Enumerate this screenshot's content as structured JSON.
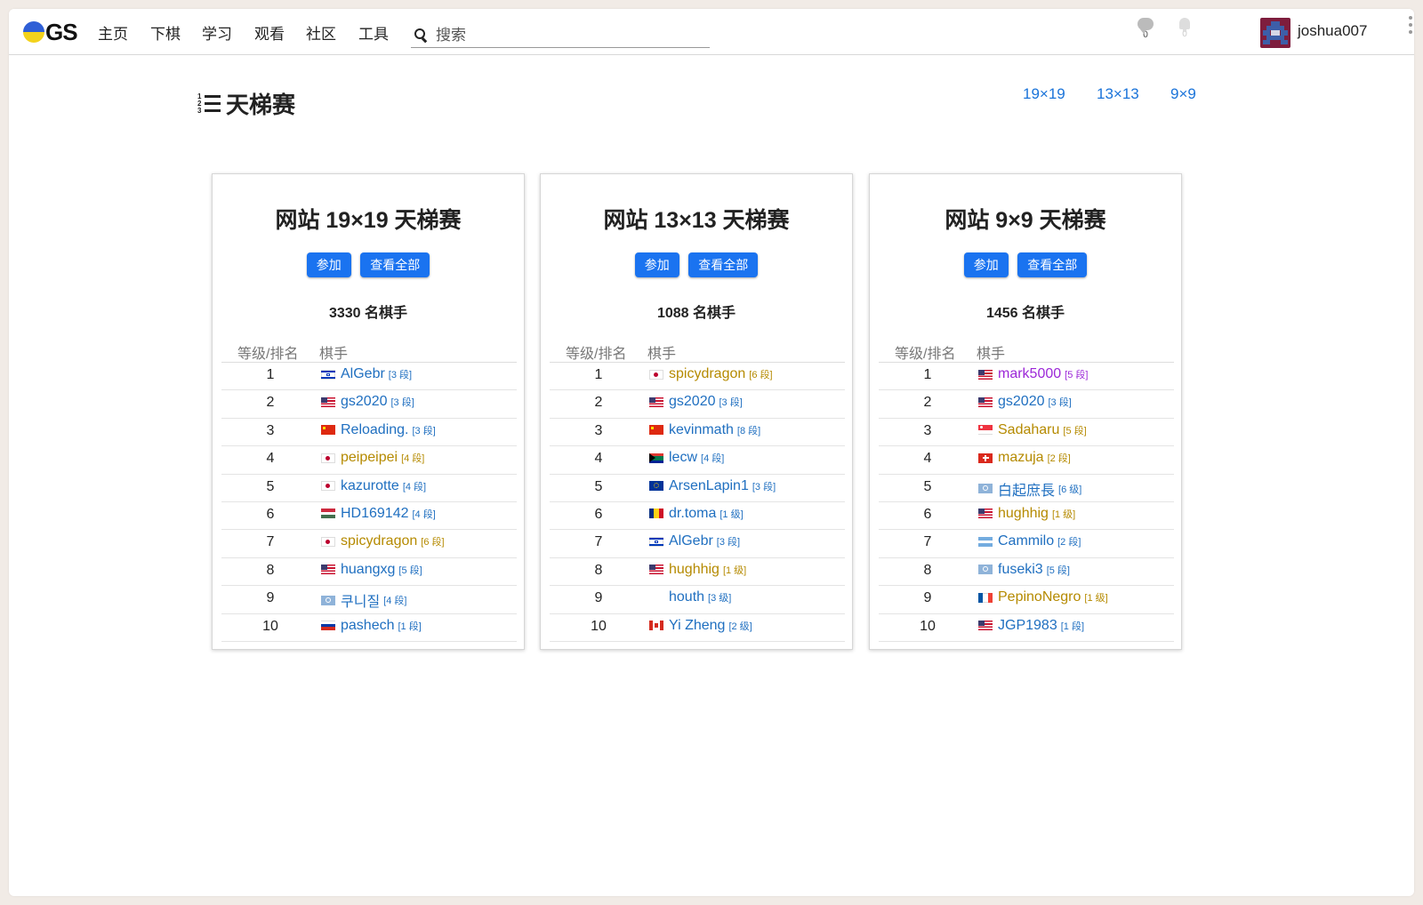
{
  "nav": {
    "logo_text": "GS",
    "items": [
      "主页",
      "下棋",
      "学习",
      "观看",
      "社区",
      "工具"
    ],
    "search_placeholder": "搜索",
    "chat_count": "0",
    "notif_count": "0",
    "username": "joshua007",
    "logo_colors": {
      "top": "#2f5fd6",
      "bottom": "#f3d21c"
    }
  },
  "page": {
    "title": "天梯赛",
    "size_links": [
      "19×19",
      "13×13",
      "9×9"
    ]
  },
  "header_cols": {
    "rank": "等级/排名",
    "player": "棋手"
  },
  "buttons": {
    "join": "参加",
    "view_all": "查看全部"
  },
  "ladders": [
    {
      "title": "网站 19×19 天梯赛",
      "players_count": "3330 名棋手",
      "rows": [
        {
          "rank": "1",
          "flag": "il",
          "name": "AlGebr",
          "rk": "[3 段]",
          "color": "blue"
        },
        {
          "rank": "2",
          "flag": "us",
          "name": "gs2020",
          "rk": "[3 段]",
          "color": "blue"
        },
        {
          "rank": "3",
          "flag": "cn",
          "name": "Reloading.",
          "rk": "[3 段]",
          "color": "blue"
        },
        {
          "rank": "4",
          "flag": "jp",
          "name": "peipeipei",
          "rk": "[4 段]",
          "color": "gold"
        },
        {
          "rank": "5",
          "flag": "jp",
          "name": "kazurotte",
          "rk": "[4 段]",
          "color": "blue"
        },
        {
          "rank": "6",
          "flag": "hu",
          "name": "HD169142",
          "rk": "[4 段]",
          "color": "blue"
        },
        {
          "rank": "7",
          "flag": "jp",
          "name": "spicydragon",
          "rk": "[6 段]",
          "color": "gold"
        },
        {
          "rank": "8",
          "flag": "us",
          "name": "huangxg",
          "rk": "[5 段]",
          "color": "blue"
        },
        {
          "rank": "9",
          "flag": "un",
          "name": "쿠니질",
          "rk": "[4 段]",
          "color": "blue"
        },
        {
          "rank": "10",
          "flag": "ru",
          "name": "pashech",
          "rk": "[1 段]",
          "color": "blue"
        }
      ]
    },
    {
      "title": "网站 13×13 天梯赛",
      "players_count": "1088 名棋手",
      "rows": [
        {
          "rank": "1",
          "flag": "jp",
          "name": "spicydragon",
          "rk": "[6 段]",
          "color": "gold"
        },
        {
          "rank": "2",
          "flag": "us",
          "name": "gs2020",
          "rk": "[3 段]",
          "color": "blue"
        },
        {
          "rank": "3",
          "flag": "cn",
          "name": "kevinmath",
          "rk": "[8 段]",
          "color": "blue"
        },
        {
          "rank": "4",
          "flag": "za",
          "name": "lecw",
          "rk": "[4 段]",
          "color": "blue"
        },
        {
          "rank": "5",
          "flag": "eu",
          "name": "ArsenLapin1",
          "rk": "[3 段]",
          "color": "blue"
        },
        {
          "rank": "6",
          "flag": "ro",
          "name": "dr.toma",
          "rk": "[1 级]",
          "color": "blue"
        },
        {
          "rank": "7",
          "flag": "il",
          "name": "AlGebr",
          "rk": "[3 段]",
          "color": "blue"
        },
        {
          "rank": "8",
          "flag": "us",
          "name": "hughhig",
          "rk": "[1 级]",
          "color": "gold"
        },
        {
          "rank": "9",
          "flag": "none",
          "name": "houth",
          "rk": "[3 级]",
          "color": "blue"
        },
        {
          "rank": "10",
          "flag": "ca",
          "name": "Yi Zheng",
          "rk": "[2 级]",
          "color": "blue"
        }
      ]
    },
    {
      "title": "网站 9×9 天梯赛",
      "players_count": "1456 名棋手",
      "rows": [
        {
          "rank": "1",
          "flag": "us",
          "name": "mark5000",
          "rk": "[5 段]",
          "color": "purple"
        },
        {
          "rank": "2",
          "flag": "us",
          "name": "gs2020",
          "rk": "[3 段]",
          "color": "blue"
        },
        {
          "rank": "3",
          "flag": "sg",
          "name": "Sadaharu",
          "rk": "[5 段]",
          "color": "gold"
        },
        {
          "rank": "4",
          "flag": "ch",
          "name": "mazuja",
          "rk": "[2 段]",
          "color": "gold"
        },
        {
          "rank": "5",
          "flag": "un",
          "name": "白起庶長",
          "rk": "[6 级]",
          "color": "blue"
        },
        {
          "rank": "6",
          "flag": "us",
          "name": "hughhig",
          "rk": "[1 级]",
          "color": "gold"
        },
        {
          "rank": "7",
          "flag": "ar",
          "name": "Cammilo",
          "rk": "[2 段]",
          "color": "blue"
        },
        {
          "rank": "8",
          "flag": "un",
          "name": "fuseki3",
          "rk": "[5 段]",
          "color": "blue"
        },
        {
          "rank": "9",
          "flag": "fr",
          "name": "PepinoNegro",
          "rk": "[1 级]",
          "color": "gold"
        },
        {
          "rank": "10",
          "flag": "us",
          "name": "JGP1983",
          "rk": "[1 段]",
          "color": "blue"
        }
      ]
    }
  ]
}
